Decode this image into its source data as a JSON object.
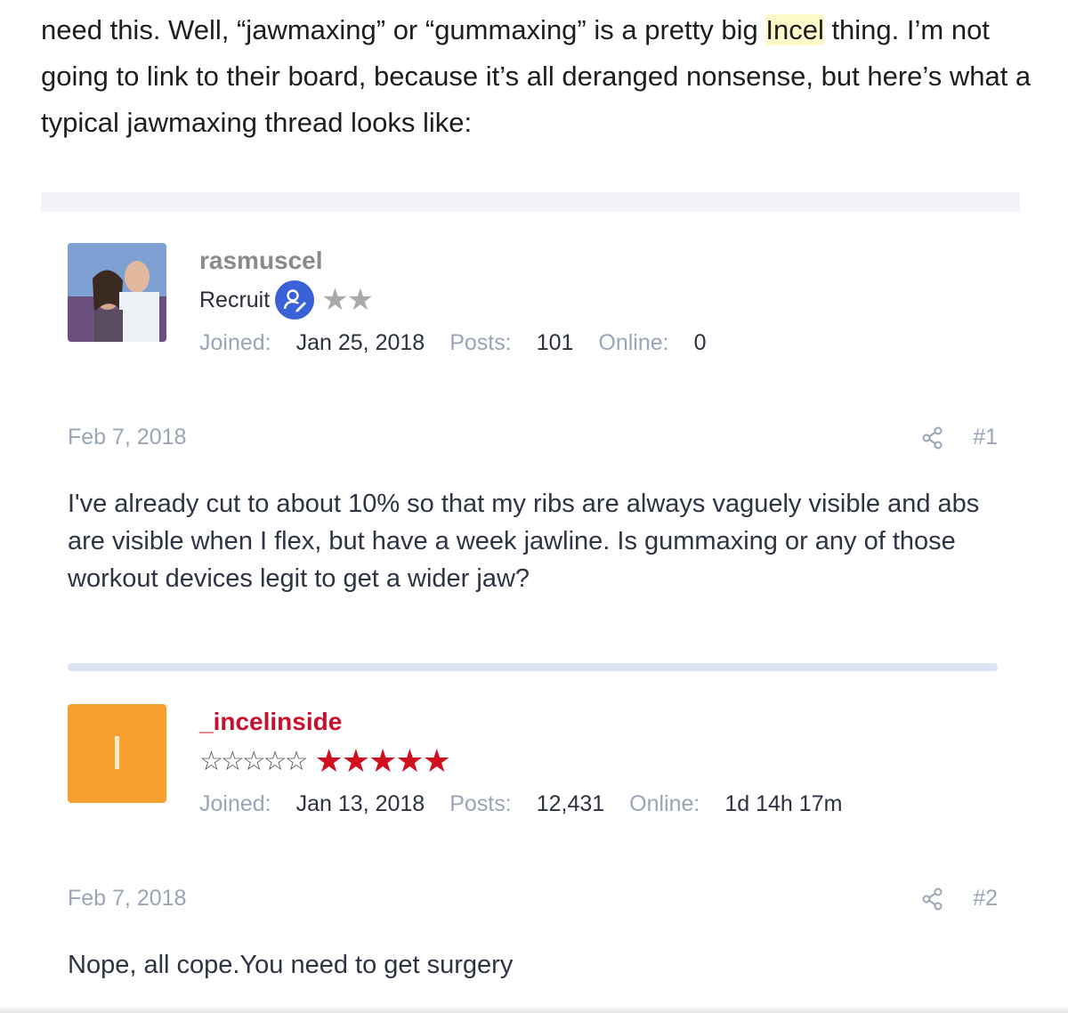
{
  "intro": {
    "line1_before": "need this. Well, “jawmaxing” or “gummaxing” is a pretty big ",
    "line1_highlight": "Incel",
    "line1_after": " thing. I’m not going to link to their board, because it’s all deranged nonsense, but here’s what a typical jawmaxing thread looks like:"
  },
  "posts": [
    {
      "username": "rasmuscel",
      "rank": "Recruit",
      "rank_icon": "user-edit-icon",
      "stars": "★★",
      "joined_label": "Joined:",
      "joined": "Jan 25, 2018",
      "posts_label": "Posts:",
      "posts": "101",
      "online_label": "Online:",
      "online": "0",
      "date": "Feb 7, 2018",
      "number": "#1",
      "body": "I've already cut to about 10% so that my ribs are always vaguely visible and abs are visible when I flex, but have a week jawline. Is gummaxing or any of those workout devices legit to get a wider jaw?"
    },
    {
      "username": "_incelinside",
      "avatar_letter": "I",
      "outline_stars": "☆☆☆☆☆",
      "stars": "★★★★★",
      "joined_label": "Joined:",
      "joined": "Jan 13, 2018",
      "posts_label": "Posts:",
      "posts": "12,431",
      "online_label": "Online:",
      "online": "1d 14h 17m",
      "date": "Feb 7, 2018",
      "number": "#2",
      "body": "Nope, all cope.You need to get surgery"
    }
  ],
  "colors": {
    "username1": "#8a8a8a",
    "username2": "#c8102e",
    "avatar2_bg": "#f79f2f",
    "rank_icon_bg": "#3a62d6",
    "highlight": "#fdf9c9"
  }
}
